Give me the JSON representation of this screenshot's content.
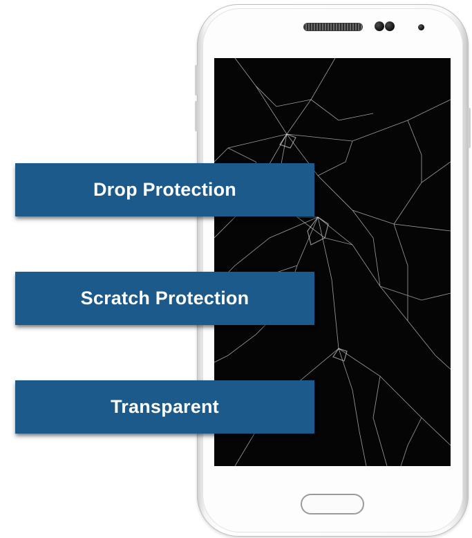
{
  "features": [
    {
      "label": "Drop Protection"
    },
    {
      "label": "Scratch Protection"
    },
    {
      "label": "Transparent"
    }
  ],
  "colors": {
    "label_background": "#1d5a8c",
    "label_text": "#ffffff",
    "screen": "#050505",
    "phone_body": "#ffffff"
  },
  "icons": {
    "phone": "smartphone-icon",
    "screen_damage": "cracked-glass"
  }
}
